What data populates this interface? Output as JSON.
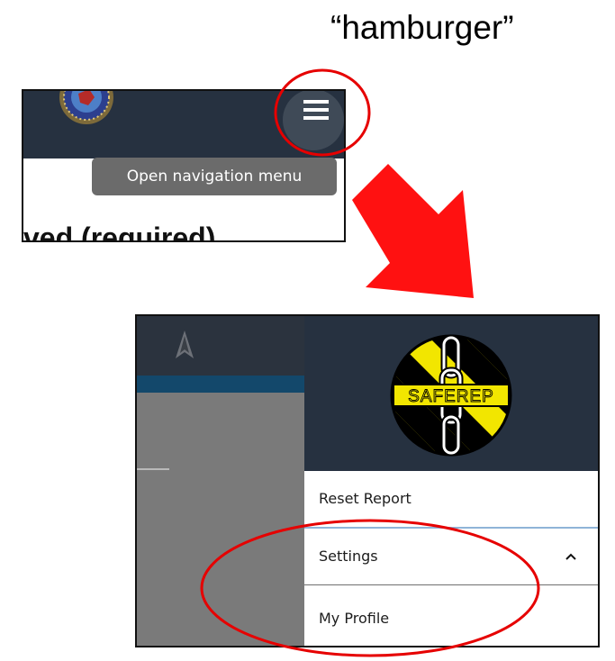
{
  "caption": "“hamburger”",
  "top_screenshot": {
    "tooltip": "Open navigation menu",
    "cut_off_text": "ved (required)",
    "icons": [
      "seal-logo",
      "hamburger-menu-icon"
    ]
  },
  "bottom_screenshot": {
    "logo_text": "SAFEREP",
    "menu": {
      "reset_report": "Reset Report",
      "settings": "Settings",
      "my_profile": "My Profile"
    },
    "icons": [
      "navigation-arrow-icon",
      "chevron-up-icon",
      "saferep-logo"
    ]
  },
  "colors": {
    "header": "#263140",
    "annotation_red": "#e60000",
    "tooltip": "#6b6b6b",
    "logo_yellow": "#f2e600"
  }
}
